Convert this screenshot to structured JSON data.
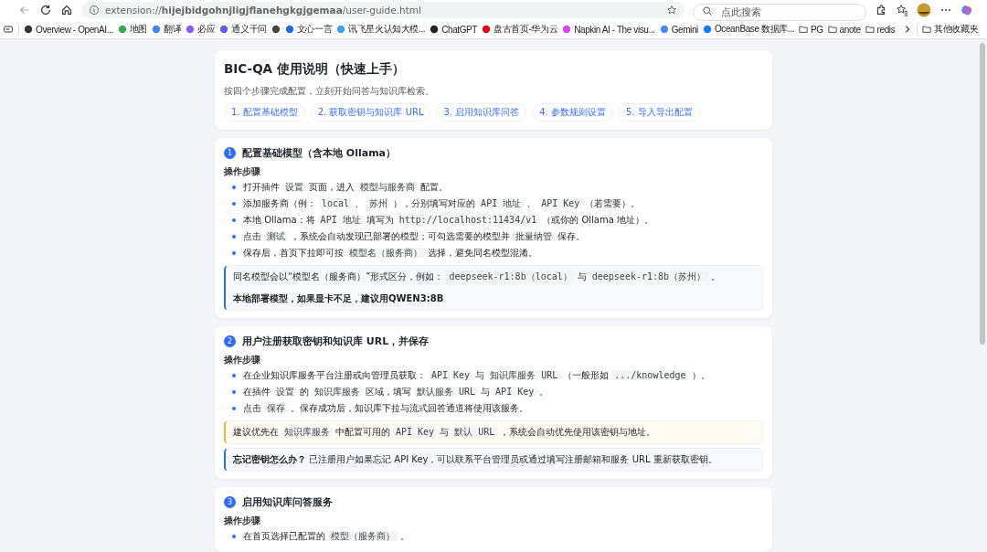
{
  "browser": {
    "address": "extension://**hijejbidgohnjligjflanehgkgjgemaa**/user-guide.html",
    "search_placeholder": "点此搜索",
    "bookmarks": [
      {
        "kind": "site",
        "label": "Overview - OpenAI...",
        "color": "#333333"
      },
      {
        "kind": "site",
        "label": "地图",
        "color": "#34a853"
      },
      {
        "kind": "site",
        "label": "翻译",
        "color": "#4285f4"
      },
      {
        "kind": "site",
        "label": "必应",
        "color": "#8a5cf6"
      },
      {
        "kind": "site",
        "label": "通义千问",
        "color": "#615ced"
      },
      {
        "kind": "site",
        "color": "#444444"
      },
      {
        "kind": "site",
        "label": "文心一言",
        "color": "#2468f2"
      },
      {
        "kind": "site",
        "label": "讯飞星火认知大模...",
        "color": "#3d9cf5"
      },
      {
        "kind": "site",
        "label": "ChatGPT",
        "color": "#222222"
      },
      {
        "kind": "site",
        "label": "盘古首页-华为云",
        "color": "#e60012"
      },
      {
        "kind": "site",
        "label": "Napkin AI - The visu...",
        "color": "#d946ef"
      },
      {
        "kind": "site",
        "label": "Gemini",
        "color": "#4f86f7"
      },
      {
        "kind": "site",
        "label": "OceanBase 数据库...",
        "color": "#1677ff"
      },
      {
        "kind": "folder",
        "label": "PG"
      },
      {
        "kind": "folder",
        "label": "anote"
      },
      {
        "kind": "folder",
        "label": "redis"
      }
    ],
    "other_bookmarks": "其他收藏夹"
  },
  "guide": {
    "title": "BIC-QA 使用说明（快速上手）",
    "subtitle": "按四个步骤完成配置，立刻开始问答与知识库检索。",
    "nav": [
      "1. 配置基础模型",
      "2. 获取密钥与知识库 URL",
      "3. 启用知识库问答",
      "4. 参数规则设置",
      "5. 导入导出配置"
    ]
  },
  "sections": [
    {
      "number": "1",
      "title": "配置基础模型（含本地 Ollama）",
      "steps_heading": "操作步骤",
      "steps": [
        [
          {
            "text": "打开插件",
            "code": false
          },
          {
            "text": "设置",
            "code": true
          },
          {
            "text": "页面，进入",
            "code": false
          },
          {
            "text": "模型与服务商",
            "code": true
          },
          {
            "text": "配置。",
            "code": false
          }
        ],
        [
          {
            "text": "添加服务商（例：",
            "code": false
          },
          {
            "text": "local",
            "code": true
          },
          {
            "text": "、",
            "code": false
          },
          {
            "text": "苏州",
            "code": true
          },
          {
            "text": "），分别填写对应的",
            "code": false
          },
          {
            "text": "API 地址",
            "code": true
          },
          {
            "text": "、",
            "code": false
          },
          {
            "text": "API Key",
            "code": true
          },
          {
            "text": "（若需要）。",
            "code": false
          }
        ],
        [
          {
            "text": "本地 Ollama：将",
            "code": false
          },
          {
            "text": "API 地址",
            "code": true
          },
          {
            "text": "填写为",
            "code": false
          },
          {
            "text": "http://localhost:11434/v1",
            "code": true
          },
          {
            "text": "（或你的 Ollama 地址）。",
            "code": false
          }
        ],
        [
          {
            "text": "点击",
            "code": false
          },
          {
            "text": "测试",
            "code": true
          },
          {
            "text": "，系统会自动发现已部署的模型；可勾选需要的模型并",
            "code": false
          },
          {
            "text": "批量纳管",
            "code": true
          },
          {
            "text": "保存。",
            "code": false
          }
        ],
        [
          {
            "text": "保存后，首页下拉即可按",
            "code": false
          },
          {
            "text": "模型名（服务商）",
            "code": true
          },
          {
            "text": "选择，避免同名模型混淆。",
            "code": false
          }
        ]
      ],
      "notes": [
        {
          "kind": "info",
          "lines": [
            [
              {
                "text": "同名模型会以“模型名（服务商）”形式区分，例如：",
                "code": false
              },
              {
                "text": "deepseek-r1:8b（local）",
                "code": true
              },
              {
                "text": "与",
                "code": false
              },
              {
                "text": "deepseek-r1:8b（苏州）",
                "code": true
              },
              {
                "text": "。",
                "code": false
              }
            ],
            [
              {
                "text": "本地部署模型，如果显卡不足，建议用QWEN3:8B",
                "code": false,
                "bold": true
              }
            ]
          ]
        }
      ]
    },
    {
      "number": "2",
      "title": "用户注册获取密钥和知识库 URL，并保存",
      "steps_heading": "操作步骤",
      "steps": [
        [
          {
            "text": "在企业知识库服务平台注册或向管理员获取：",
            "code": false
          },
          {
            "text": "API Key",
            "code": true
          },
          {
            "text": "与",
            "code": false
          },
          {
            "text": "知识库服务 URL",
            "code": true
          },
          {
            "text": "（一般形如",
            "code": false
          },
          {
            "text": ".../knowledge",
            "code": true
          },
          {
            "text": "）。",
            "code": false
          }
        ],
        [
          {
            "text": "在插件",
            "code": false
          },
          {
            "text": "设置",
            "code": true
          },
          {
            "text": "的",
            "code": false
          },
          {
            "text": "知识库服务",
            "code": true
          },
          {
            "text": "区域，填写",
            "code": false
          },
          {
            "text": "默认服务 URL",
            "code": true
          },
          {
            "text": "与",
            "code": false
          },
          {
            "text": "API Key",
            "code": true
          },
          {
            "text": "。",
            "code": false
          }
        ],
        [
          {
            "text": "点击",
            "code": false
          },
          {
            "text": "保存",
            "code": true
          },
          {
            "text": "。保存成功后，知识库下拉与流式回答通道将使用该服务。",
            "code": false
          }
        ]
      ],
      "notes": [
        {
          "kind": "warn",
          "lines": [
            [
              {
                "text": "建议优先在",
                "code": false
              },
              {
                "text": "知识库服务",
                "code": true
              },
              {
                "text": "中配置可用的",
                "code": false
              },
              {
                "text": "API Key",
                "code": true
              },
              {
                "text": "与",
                "code": false
              },
              {
                "text": "默认 URL",
                "code": true
              },
              {
                "text": "，系统会自动优先使用该密钥与地址。",
                "code": false
              }
            ]
          ]
        },
        {
          "kind": "info",
          "lines": [
            [
              {
                "text": "**忘记密钥怎么办？** 已注册用户如果忘记 API Key，可以联系平台管理员或通过填写注册邮箱和服务 URL 重新获取密钥。",
                "code": false
              }
            ]
          ]
        }
      ]
    },
    {
      "number": "3",
      "title": "启用知识库问答服务",
      "steps_heading": "操作步骤",
      "steps": [
        [
          {
            "text": "在首页选择已配置的",
            "code": false
          },
          {
            "text": "模型（服务商）",
            "code": true
          },
          {
            "text": "。",
            "code": false
          }
        ]
      ]
    }
  ]
}
